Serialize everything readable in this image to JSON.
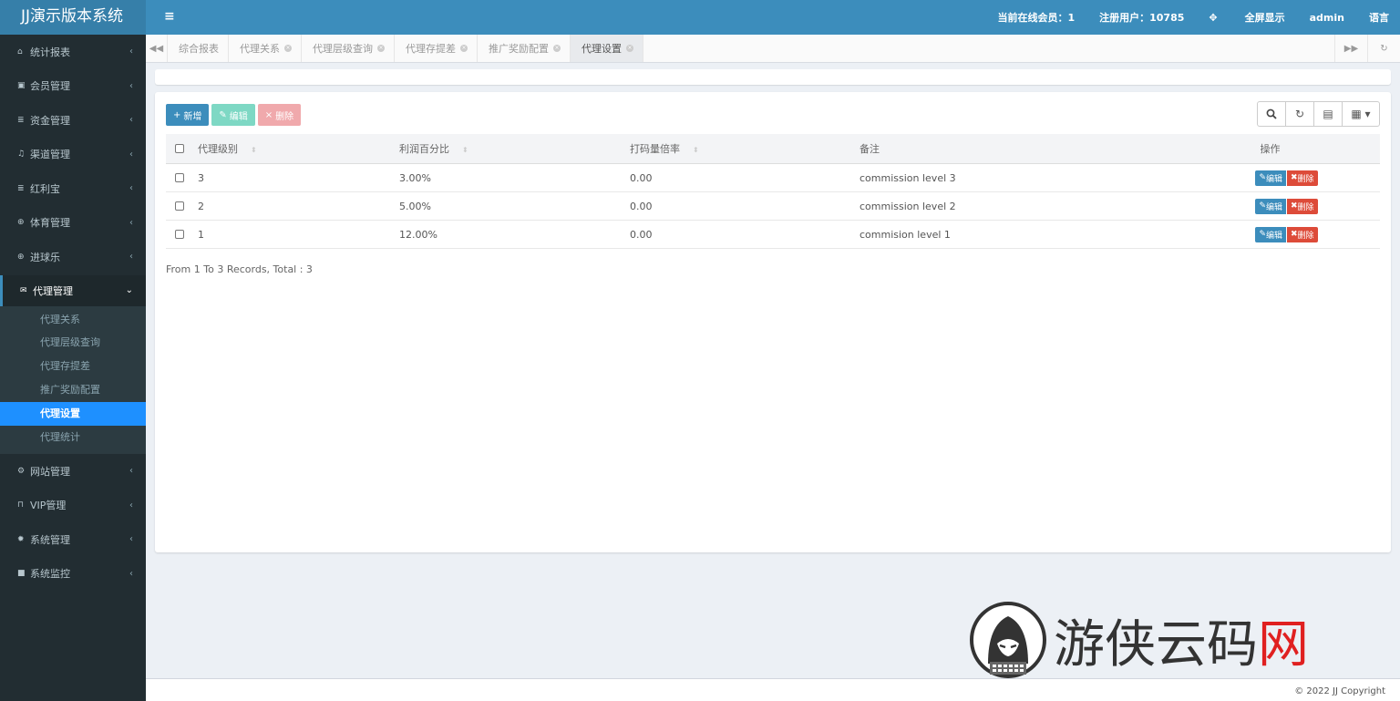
{
  "app": {
    "title": "JJ演示版本系统"
  },
  "header": {
    "menu_toggle_icon": "hamburger-icon",
    "online_label": "当前在线会员：1",
    "registered_label": "注册用户：10785",
    "fullscreen_label": "全屏显示",
    "user": "admin",
    "language": "语言"
  },
  "sidebar": {
    "items_top": [
      {
        "label": "统计报表",
        "icon": "home-icon"
      },
      {
        "label": "会员管理",
        "icon": "user-card-icon"
      },
      {
        "label": "资金管理",
        "icon": "database-icon"
      },
      {
        "label": "渠道管理",
        "icon": "music-icon"
      },
      {
        "label": "红利宝",
        "icon": "database-icon"
      },
      {
        "label": "体育管理",
        "icon": "soccer-icon"
      },
      {
        "label": "进球乐",
        "icon": "soccer-icon"
      }
    ],
    "active_group": {
      "label": "代理管理",
      "icon": "envelope-icon"
    },
    "sub_items": [
      {
        "label": "代理关系"
      },
      {
        "label": "代理层级查询"
      },
      {
        "label": "代理存提差"
      },
      {
        "label": "推广奖励配置"
      },
      {
        "label": "代理设置",
        "active": true
      },
      {
        "label": "代理统计"
      }
    ],
    "items_bottom": [
      {
        "label": "网站管理",
        "icon": "cogs-icon"
      },
      {
        "label": "VIP管理",
        "icon": "lock-icon"
      },
      {
        "label": "系统管理",
        "icon": "gear-icon"
      },
      {
        "label": "系统监控",
        "icon": "video-icon"
      }
    ]
  },
  "tabs": [
    {
      "label": "综合报表",
      "closable": false
    },
    {
      "label": "代理关系",
      "closable": true
    },
    {
      "label": "代理层级查询",
      "closable": true
    },
    {
      "label": "代理存提差",
      "closable": true
    },
    {
      "label": "推广奖励配置",
      "closable": true
    },
    {
      "label": "代理设置",
      "closable": true,
      "active": true
    }
  ],
  "toolbar": {
    "add_label": "新增",
    "edit_label": "编辑",
    "delete_label": "删除"
  },
  "table": {
    "columns": [
      "代理级别",
      "利润百分比",
      "打码量倍率",
      "备注",
      "操作"
    ],
    "rows": [
      {
        "level": "3",
        "profit": "3.00%",
        "multiplier": "0.00",
        "remark": "commission level 3"
      },
      {
        "level": "2",
        "profit": "5.00%",
        "multiplier": "0.00",
        "remark": "commission level 2"
      },
      {
        "level": "1",
        "profit": "12.00%",
        "multiplier": "0.00",
        "remark": "commision level 1"
      }
    ],
    "row_edit_label": "编辑",
    "row_delete_label": "删除",
    "summary": "From 1 To 3 Records, Total : 3"
  },
  "footer": {
    "copyright": "© 2022 JJ Copyright"
  },
  "watermark": {
    "text_main": "游侠云码",
    "text_red": "网"
  },
  "colors": {
    "header": "#3c8dbc",
    "sidebar": "#222d32",
    "active_sub": "#1e90ff",
    "danger": "#dd4b39"
  }
}
